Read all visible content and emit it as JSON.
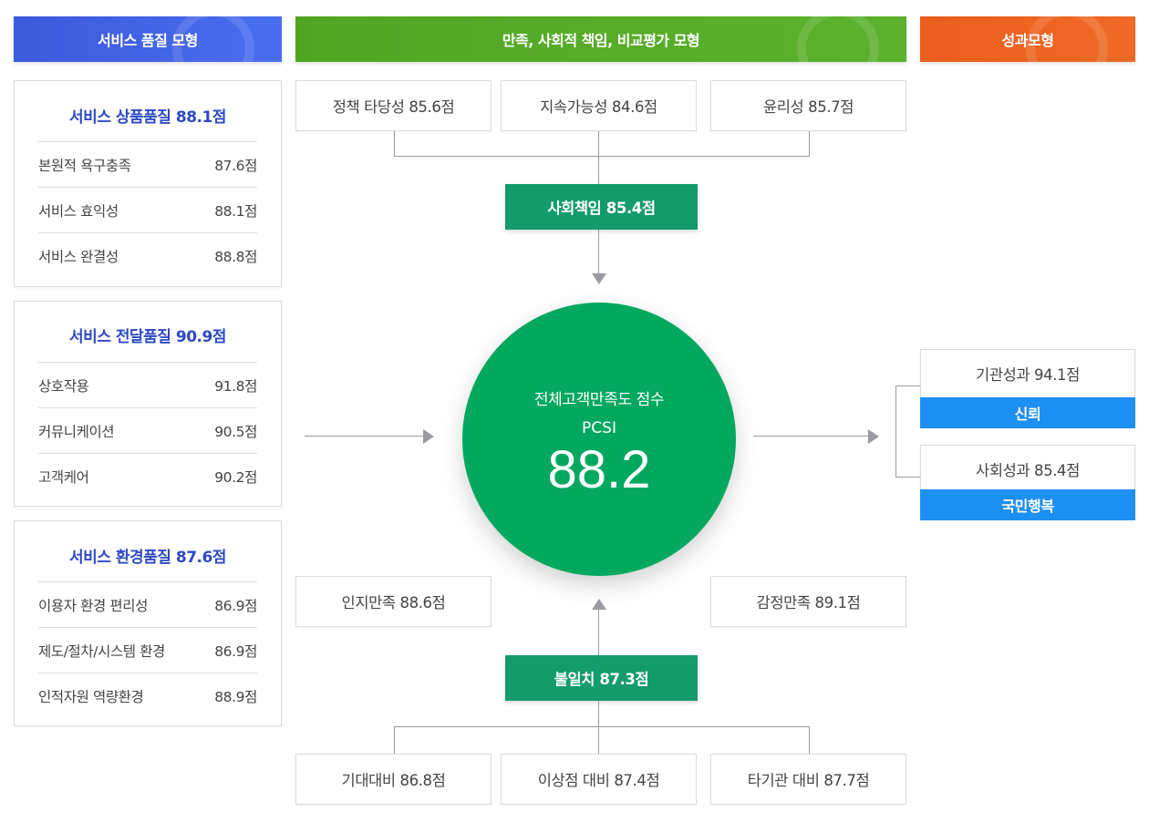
{
  "headers": {
    "quality": "서비스 품질 모형",
    "satisfaction": "만족, 사회적 책임, 비교평가 모형",
    "performance": "성과모형"
  },
  "colors": {
    "quality_header": "#3a5cdc",
    "satisfaction_header": "#55a726",
    "performance_header": "#ee6020",
    "green_box": "#139b6b",
    "circle": "#03a85f",
    "blue_label": "#1e8ff2",
    "panel_title": "#2e49c4"
  },
  "panels": [
    {
      "title": "서비스 상품품질 88.1점",
      "rows": [
        {
          "label": "본원적 욕구충족",
          "value": "87.6점"
        },
        {
          "label": "서비스 효익성",
          "value": "88.1점"
        },
        {
          "label": "서비스 완결성",
          "value": "88.8점"
        }
      ]
    },
    {
      "title": "서비스 전달품질 90.9점",
      "rows": [
        {
          "label": "상호작용",
          "value": "91.8점"
        },
        {
          "label": "커뮤니케이션",
          "value": "90.5점"
        },
        {
          "label": "고객케어",
          "value": "90.2점"
        }
      ]
    },
    {
      "title": "서비스 환경품질 87.6점",
      "rows": [
        {
          "label": "이용자 환경 편리성",
          "value": "86.9점"
        },
        {
          "label": "제도/절차/시스템 환경",
          "value": "86.9점"
        },
        {
          "label": "인적자원 역량환경",
          "value": "88.9점"
        }
      ]
    }
  ],
  "social_top": [
    "정책 타당성 85.6점",
    "지속가능성 84.6점",
    "윤리성 85.7점"
  ],
  "social_responsibility": "사회책임 85.4점",
  "center": {
    "label": "전체고객만족도 점수",
    "sub": "PCSI",
    "score": "88.2"
  },
  "middle_boxes": {
    "left": "인지만족 88.6점",
    "right": "감정만족 89.1점"
  },
  "mismatch": "불일치 87.3점",
  "compare_bottom": [
    "기대대비 86.8점",
    "이상점 대비 87.4점",
    "타기관 대비 87.7점"
  ],
  "performance": [
    {
      "label": "기관성과 94.1점",
      "tag": "신뢰"
    },
    {
      "label": "사회성과 85.4점",
      "tag": "국민행복"
    }
  ]
}
